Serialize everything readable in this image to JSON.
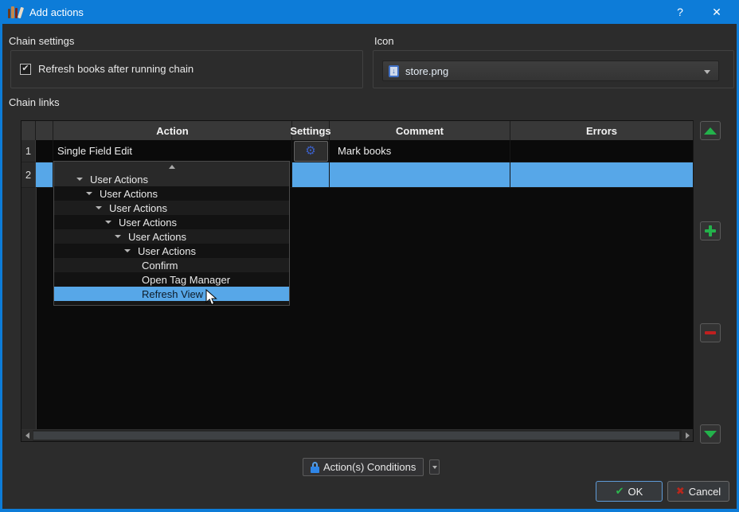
{
  "window": {
    "title": "Add actions",
    "help_glyph": "?",
    "close_glyph": "✕"
  },
  "chain_settings": {
    "label": "Chain settings",
    "checkbox": {
      "label": "Refresh books after running chain",
      "checked": true
    }
  },
  "icon_section": {
    "label": "Icon",
    "selected_icon": "store.png"
  },
  "chain_links": {
    "label": "Chain links",
    "table": {
      "columns": [
        "Action",
        "Settings",
        "Comment",
        "Errors"
      ],
      "rows": [
        {
          "num": "1",
          "action": "Single Field Edit",
          "has_settings_button": true,
          "comment": "Mark books",
          "errors": "",
          "selected": false
        },
        {
          "num": "2",
          "action": "",
          "comment": "",
          "errors": "",
          "selected": true,
          "editing": true
        }
      ]
    },
    "action_dropdown": {
      "items": [
        {
          "label": "User Actions",
          "depth": 1,
          "expanded": true
        },
        {
          "label": "User Actions",
          "depth": 2,
          "expanded": true
        },
        {
          "label": "User Actions",
          "depth": 3,
          "expanded": true
        },
        {
          "label": "User Actions",
          "depth": 4,
          "expanded": true
        },
        {
          "label": "User Actions",
          "depth": 5,
          "expanded": true
        },
        {
          "label": "User Actions",
          "depth": 6,
          "expanded": true
        },
        {
          "label": "Confirm",
          "leaf": true
        },
        {
          "label": "Open Tag Manager",
          "leaf": true
        },
        {
          "label": "Refresh View",
          "leaf": true,
          "highlighted": true
        }
      ]
    },
    "side_buttons": [
      {
        "name": "move-up",
        "icon": "green-up-triangle"
      },
      {
        "name": "add",
        "icon": "green-plus"
      },
      {
        "name": "remove",
        "icon": "red-minus"
      },
      {
        "name": "move-down",
        "icon": "green-down-triangle"
      }
    ]
  },
  "footer": {
    "conditions_label": "Action(s) Conditions",
    "ok_label": "OK",
    "cancel_label": "Cancel"
  },
  "icons": {
    "gear": "⚙",
    "ok_check": "✔",
    "cancel_cross": "✖",
    "checkbox_check": "✔",
    "store_arrow": "↓"
  },
  "colors": {
    "titlebar_blue": "#0d7cd8",
    "selection_blue": "#57a7e8",
    "gear_blue": "#3b5fc6",
    "lock_blue": "#2f86e8",
    "ok_green": "#2db84e",
    "cancel_red": "#b8271c",
    "add_green": "#23b24b",
    "remove_red": "#c01f1f"
  }
}
